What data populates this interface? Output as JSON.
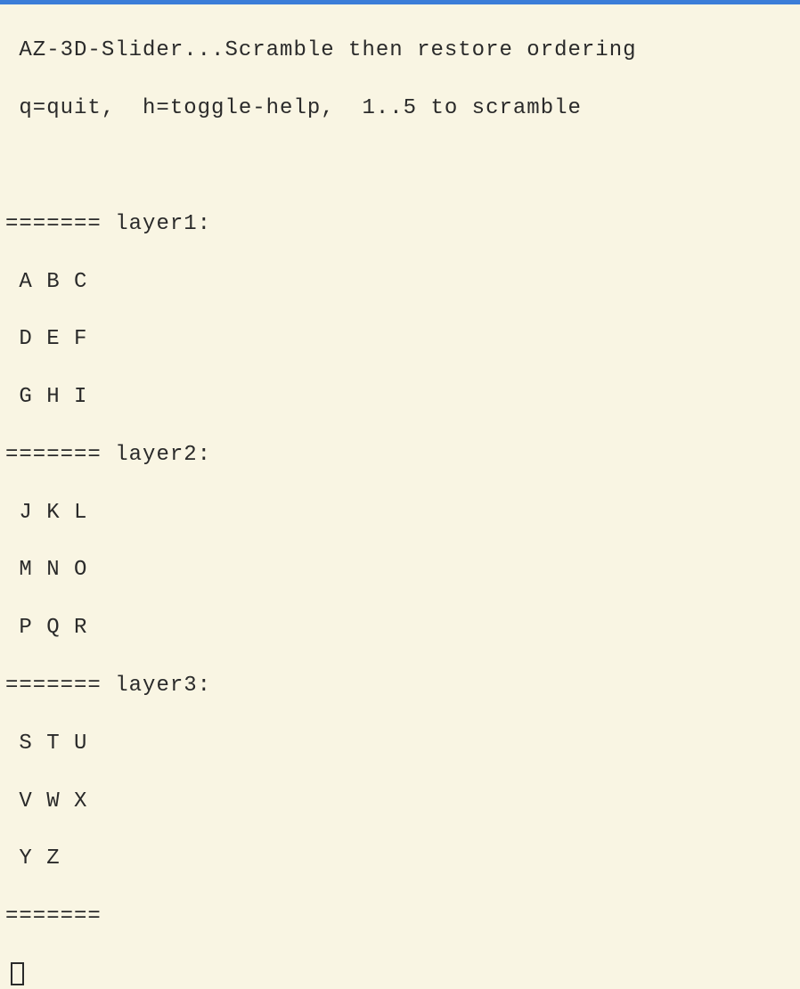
{
  "title": " AZ-3D-Slider...Scramble then restore ordering",
  "help_line": " q=quit,  h=toggle-help,  1..5 to scramble",
  "divider": "=======",
  "layers": [
    {
      "label": "layer1:",
      "rows": [
        " A B C",
        " D E F",
        " G H I"
      ]
    },
    {
      "label": "layer2:",
      "rows": [
        " J K L",
        " M N O",
        " P Q R"
      ]
    },
    {
      "label": "layer3:",
      "rows": [
        " S T U",
        " V W X",
        " Y Z"
      ]
    }
  ]
}
